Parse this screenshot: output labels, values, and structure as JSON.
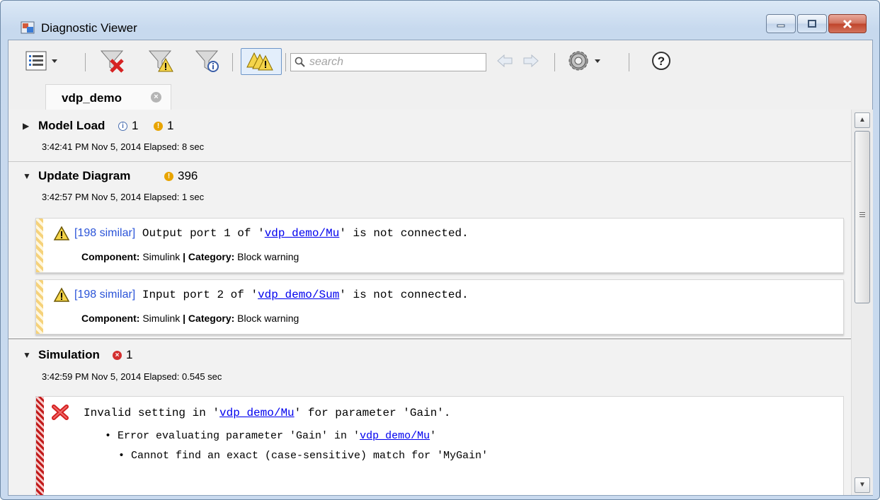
{
  "window": {
    "title": "Diagnostic Viewer"
  },
  "toolbar": {
    "search_placeholder": "search"
  },
  "tabs": [
    {
      "label": "vdp_demo"
    }
  ],
  "sections": [
    {
      "title": "Model Load",
      "info_count": "1",
      "warn_count": "1",
      "time": "3:42:41 PM Nov 5, 2014  Elapsed: 8 sec"
    },
    {
      "title": "Update Diagram",
      "warn_count": "396",
      "time": "3:42:57 PM Nov 5, 2014  Elapsed: 1 sec",
      "messages": [
        {
          "similar": "[198 similar]",
          "text_before": " Output port 1 of '",
          "link": "vdp_demo/Mu",
          "text_after": "' is not connected.",
          "component_label": "Component:",
          "component": " Simulink ",
          "separator": "|",
          "category_label": " Category:",
          "category": " Block warning"
        },
        {
          "similar": "[198 similar]",
          "text_before": " Input port 2 of '",
          "link": "vdp_demo/Sum",
          "text_after": "' is not connected.",
          "component_label": "Component:",
          "component": " Simulink ",
          "separator": "|",
          "category_label": " Category:",
          "category": " Block warning"
        }
      ]
    },
    {
      "title": "Simulation",
      "err_count": "1",
      "time": "3:42:59 PM Nov 5, 2014  Elapsed: 0.545 sec",
      "error": {
        "line1_before": "Invalid setting in '",
        "line1_link": "vdp_demo/Mu",
        "line1_after": "' for parameter 'Gain'.",
        "line2_before": "• Error evaluating parameter 'Gain' in '",
        "line2_link": "vdp_demo/Mu",
        "line2_after": "'",
        "line3": "• Cannot find an exact (case-sensitive) match for 'MyGain'"
      }
    }
  ],
  "colors": {
    "link": "#0000ee",
    "similar": "#2b54d8",
    "warning": "#e8a400",
    "error": "#d32f2f"
  },
  "icons": [
    "app-icon",
    "report-menu-icon",
    "filter-errors-icon",
    "filter-warnings-icon",
    "filter-info-icon",
    "group-warnings-icon",
    "search-icon",
    "back-arrow-icon",
    "forward-arrow-icon",
    "settings-gear-icon",
    "help-icon"
  ]
}
